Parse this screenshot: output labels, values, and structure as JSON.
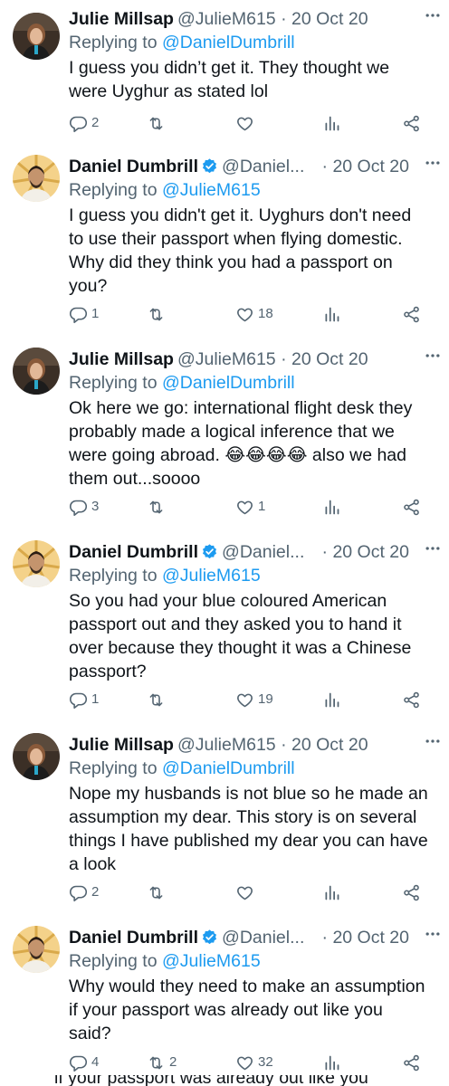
{
  "thread": [
    {
      "name": "Julie Millsap",
      "handle": "@JulieM615",
      "separator": "·",
      "time": "20 Oct 20",
      "replying_prefix": "Replying to",
      "replying_to": "@DanielDumbrill",
      "lines": [
        "I guess you didn’t get it. They thought we",
        "were Uyghur as stated lol"
      ],
      "reply_count": "2",
      "retweet_count": "",
      "like_count": ""
    },
    {
      "name": "Daniel Dumbrill",
      "handle": "@Daniel...",
      "separator": "·",
      "time": "20 Oct 20",
      "replying_prefix": "Replying to",
      "replying_to": "@JulieM615",
      "lines": [
        "I guess you didn't get it. Uyghurs don't need",
        "to use their passport when flying domestic.",
        "Why did they think you had a passport on",
        "you?"
      ],
      "reply_count": "1",
      "retweet_count": "",
      "like_count": "18"
    },
    {
      "name": "Julie Millsap",
      "handle": "@JulieM615",
      "separator": "·",
      "time": "20 Oct 20",
      "replying_prefix": "Replying to",
      "replying_to": "@DanielDumbrill",
      "lines": [
        "Ok here we go: international flight desk they",
        "probably made a logical inference that we",
        "were going abroad. 😂😂😂😂 also we had",
        "them out...soooo"
      ],
      "reply_count": "3",
      "retweet_count": "",
      "like_count": "1"
    },
    {
      "name": "Daniel Dumbrill",
      "handle": "@Daniel...",
      "separator": "·",
      "time": "20 Oct 20",
      "replying_prefix": "Replying to",
      "replying_to": "@JulieM615",
      "lines": [
        "So you had your blue coloured American",
        "passport out and they asked you to hand it",
        "over because they thought it was a Chinese",
        "passport?"
      ],
      "reply_count": "1",
      "retweet_count": "",
      "like_count": "19"
    },
    {
      "name": "Julie Millsap",
      "handle": "@JulieM615",
      "separator": "·",
      "time": "20 Oct 20",
      "replying_prefix": "Replying to",
      "replying_to": "@DanielDumbrill",
      "lines": [
        "Nope my husbands is not blue so he made an",
        "assumption my dear. This story is on several",
        "things I have published my dear you can have",
        "a look"
      ],
      "reply_count": "2",
      "retweet_count": "",
      "like_count": ""
    },
    {
      "name": "Daniel Dumbrill",
      "handle": "@Daniel...",
      "separator": "·",
      "time": "20 Oct 20",
      "replying_prefix": "Replying to",
      "replying_to": "@JulieM615",
      "lines": [
        "Why would they need to make an assumption",
        "if your passport was already out like you",
        "said?"
      ],
      "reply_count": "4",
      "retweet_count": "2",
      "like_count": "32"
    }
  ],
  "cut_off_text": "if your passport was already out like you",
  "colors": {
    "text": "#0f1419",
    "muted": "#536471",
    "link": "#1d9bf0",
    "verified": "#1d9bf0"
  },
  "icons": [
    "reply-icon",
    "retweet-icon",
    "like-icon",
    "views-icon",
    "share-icon",
    "more-icon",
    "verified-badge-icon"
  ]
}
